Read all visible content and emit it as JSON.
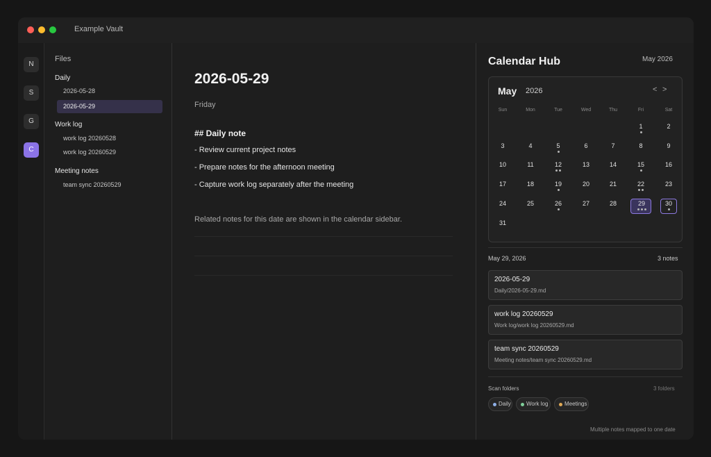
{
  "window": {
    "title": "Example Vault"
  },
  "ribbon": {
    "buttons": [
      "N",
      "S",
      "G",
      "C"
    ]
  },
  "file_tree": {
    "title": "Files",
    "groups": [
      {
        "label": "Daily",
        "items": [
          "2026-05-28",
          "2026-05-29"
        ],
        "active_item": "2026-05-29"
      },
      {
        "label": "Work log",
        "items": [
          "work log 20260528",
          "work log 20260529"
        ]
      },
      {
        "label": "Meeting notes",
        "items": [
          "team sync 20260529"
        ]
      }
    ]
  },
  "editor": {
    "title": "2026-05-29",
    "weekday": "Friday",
    "heading": "## Daily note",
    "bullets": [
      "- Review current project notes",
      "- Prepare notes for the afternoon meeting",
      "- Capture work log separately after the meeting"
    ],
    "footer_note": "Related notes for this date are shown in the calendar sidebar."
  },
  "calendar_hub": {
    "title": "Calendar Hub",
    "month_label": "May 2026",
    "calendar": {
      "month": "May",
      "year": "2026",
      "prev": "<",
      "next": ">",
      "weekdays": [
        "Sun",
        "Mon",
        "Tue",
        "Wed",
        "Thu",
        "Fri",
        "Sat"
      ],
      "first_weekday_index": 5,
      "days_in_month": 31,
      "selected_day": 29,
      "today": 30,
      "note_counts": {
        "1": 1,
        "5": 1,
        "12": 2,
        "15": 1,
        "19": 1,
        "22": 2,
        "26": 1,
        "29": 3,
        "30": 1
      }
    },
    "selected_date": "May 29, 2026",
    "notes_count": "3 notes",
    "notes": [
      {
        "title": "2026-05-29",
        "path": "Daily/2026-05-29.md"
      },
      {
        "title": "work log 20260529",
        "path": "Work log/work log 20260529.md"
      },
      {
        "title": "team sync 20260529",
        "path": "Meeting notes/team sync 20260529.md"
      }
    ],
    "scan_folders": {
      "label": "Scan folders",
      "count": "3 folders",
      "chips": [
        {
          "label": "Daily",
          "color": "#8fb0e8"
        },
        {
          "label": "Work log",
          "color": "#7fcf9a"
        },
        {
          "label": "Meetings",
          "color": "#e0a955"
        }
      ]
    },
    "footer": "Multiple notes mapped to one date"
  }
}
